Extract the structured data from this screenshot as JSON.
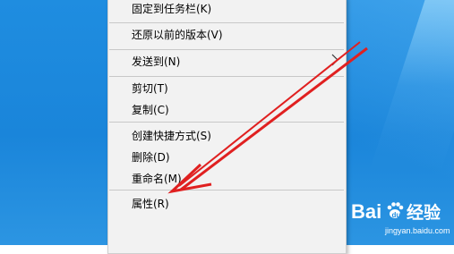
{
  "context_menu": {
    "items": [
      {
        "label": "固定到任务栏(K)"
      },
      {
        "label": "还原以前的版本(V)"
      },
      {
        "label": "发送到(N)",
        "has_submenu": true
      },
      {
        "label": "剪切(T)"
      },
      {
        "label": "复制(C)"
      },
      {
        "label": "创建快捷方式(S)"
      },
      {
        "label": "删除(D)"
      },
      {
        "label": "重命名(M)"
      },
      {
        "label": "属性(R)"
      }
    ]
  },
  "annotation": {
    "arrow_color": "#e02020",
    "points_to": "属性(R)"
  },
  "watermark": {
    "logo_text": "Bai经验",
    "url": "jingyan.baidu.com"
  },
  "colors": {
    "desktop_blue": "#1f8de0",
    "menu_bg": "#f2f2f2"
  }
}
